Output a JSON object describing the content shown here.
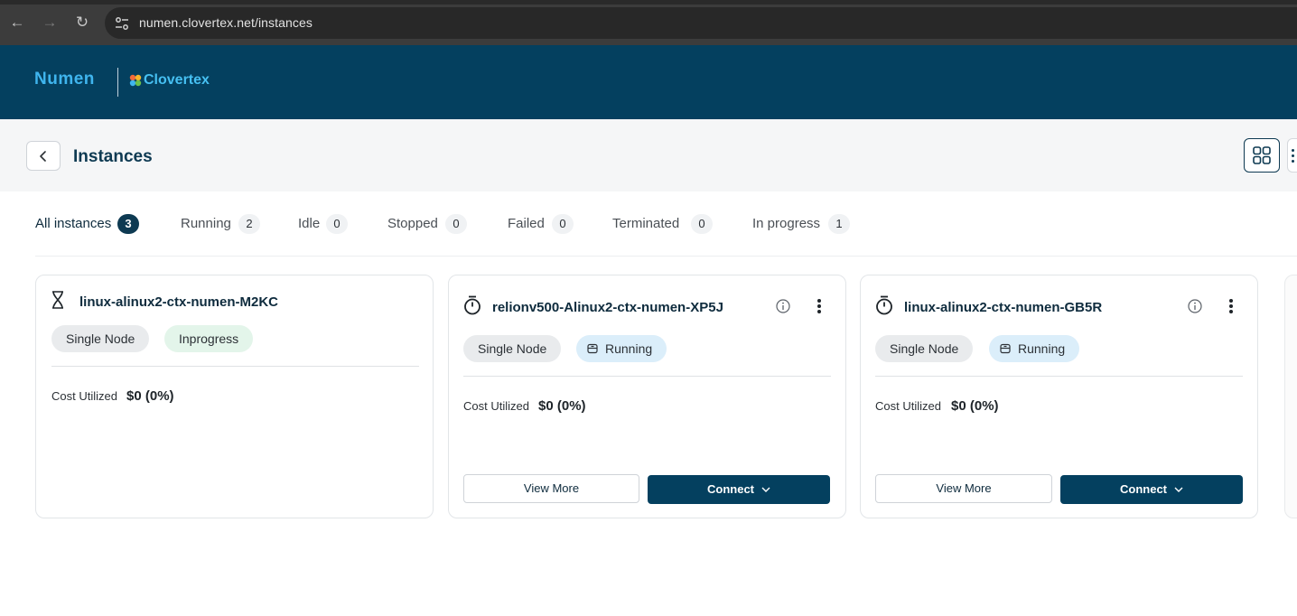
{
  "browser": {
    "url": "numen.clovertex.net/instances"
  },
  "header": {
    "brand_primary": "Numen",
    "brand_secondary": "Clovertex",
    "brand_color": "#04405f"
  },
  "page": {
    "title": "Instances"
  },
  "tabs": [
    {
      "label": "All instances",
      "count": "3",
      "active": true
    },
    {
      "label": "Running",
      "count": "2"
    },
    {
      "label": "Idle",
      "count": "0"
    },
    {
      "label": "Stopped",
      "count": "0"
    },
    {
      "label": "Failed",
      "count": "0"
    },
    {
      "label": "Terminated",
      "count": "0"
    },
    {
      "label": "In progress",
      "count": "1"
    }
  ],
  "instances": [
    {
      "name": "linux-alinux2-ctx-numen-M2KC",
      "status_icon": "hourglass-icon",
      "node_type": "Single Node",
      "status": "Inprogress",
      "cost_label": "Cost Utilized",
      "cost_value": "$0 (0%)"
    },
    {
      "name": "relionv500-Alinux2-ctx-numen-XP5J",
      "status_icon": "stopwatch-icon",
      "node_type": "Single Node",
      "status": "Running",
      "cost_label": "Cost Utilized",
      "cost_value": "$0 (0%)",
      "view_more_label": "View More",
      "connect_label": "Connect"
    },
    {
      "name": "linux-alinux2-ctx-numen-GB5R",
      "status_icon": "stopwatch-icon",
      "node_type": "Single Node",
      "status": "Running",
      "cost_label": "Cost Utilized",
      "cost_value": "$0 (0%)",
      "view_more_label": "View More",
      "connect_label": "Connect"
    }
  ]
}
